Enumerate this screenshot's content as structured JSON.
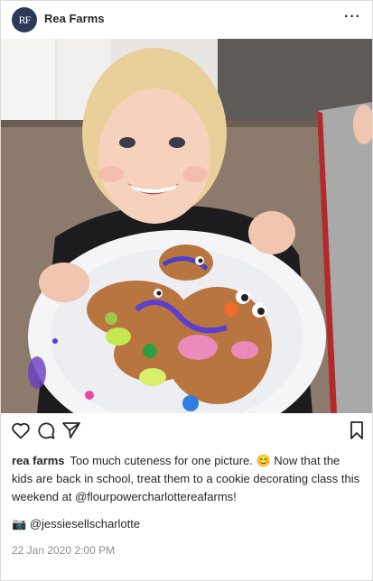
{
  "header": {
    "avatar_initials": "RF",
    "username": "Rea Farms",
    "more_label": "···"
  },
  "photo": {
    "subject": "child holding plate of decorated gingerbread cookies"
  },
  "actions": {
    "like_icon": "heart-icon",
    "comment_icon": "comment-icon",
    "share_icon": "share-icon",
    "save_icon": "bookmark-icon"
  },
  "caption": {
    "user": "rea farms",
    "text": "Too much cuteness for one picture. 😊 Now that the kids are back in school, treat them to a cookie decorating class this weekend at @flourpowercharlottereafarms!"
  },
  "credit": {
    "icon": "📷",
    "text": "@jessiesellscharlotte"
  },
  "timestamp": "22 Jan 2020 2:00 PM"
}
